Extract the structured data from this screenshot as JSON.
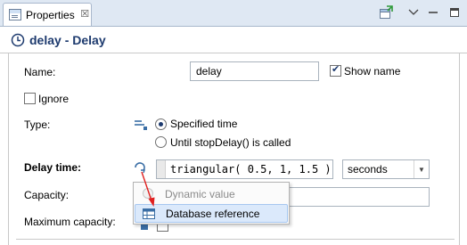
{
  "tab": {
    "label": "Properties",
    "close": "☒"
  },
  "toolbar": {
    "new_icon": "pin-to-view-icon",
    "view_menu_icon": "view-menu-icon",
    "minimize_icon": "minimize-icon",
    "maximize_icon": "maximize-icon"
  },
  "header": {
    "title": "delay - Delay",
    "icon": "clock-icon"
  },
  "form": {
    "name_label": "Name:",
    "name_value": "delay",
    "show_name_label": "Show name",
    "show_name_checked": true,
    "ignore_label": "Ignore",
    "ignore_checked": false,
    "type_label": "Type:",
    "type_options": [
      "Specified time",
      "Until stopDelay() is called"
    ],
    "type_selected": "Specified time",
    "delay_time_label": "Delay time:",
    "delay_time_code": "triangular( 0.5, 1, 1.5 )",
    "delay_time_unit": "seconds",
    "capacity_label": "Capacity:",
    "max_capacity_label": "Maximum capacity:"
  },
  "popup_menu": {
    "items": [
      {
        "label": "Dynamic value",
        "enabled": false
      },
      {
        "label": "Database reference",
        "enabled": true,
        "hovered": true
      }
    ]
  },
  "colors": {
    "tab_bar_bg": "#dfe8f3",
    "title_color": "#1d3a6e",
    "hover_bg": "#dbe9fb",
    "arrow_red": "#e02020"
  }
}
